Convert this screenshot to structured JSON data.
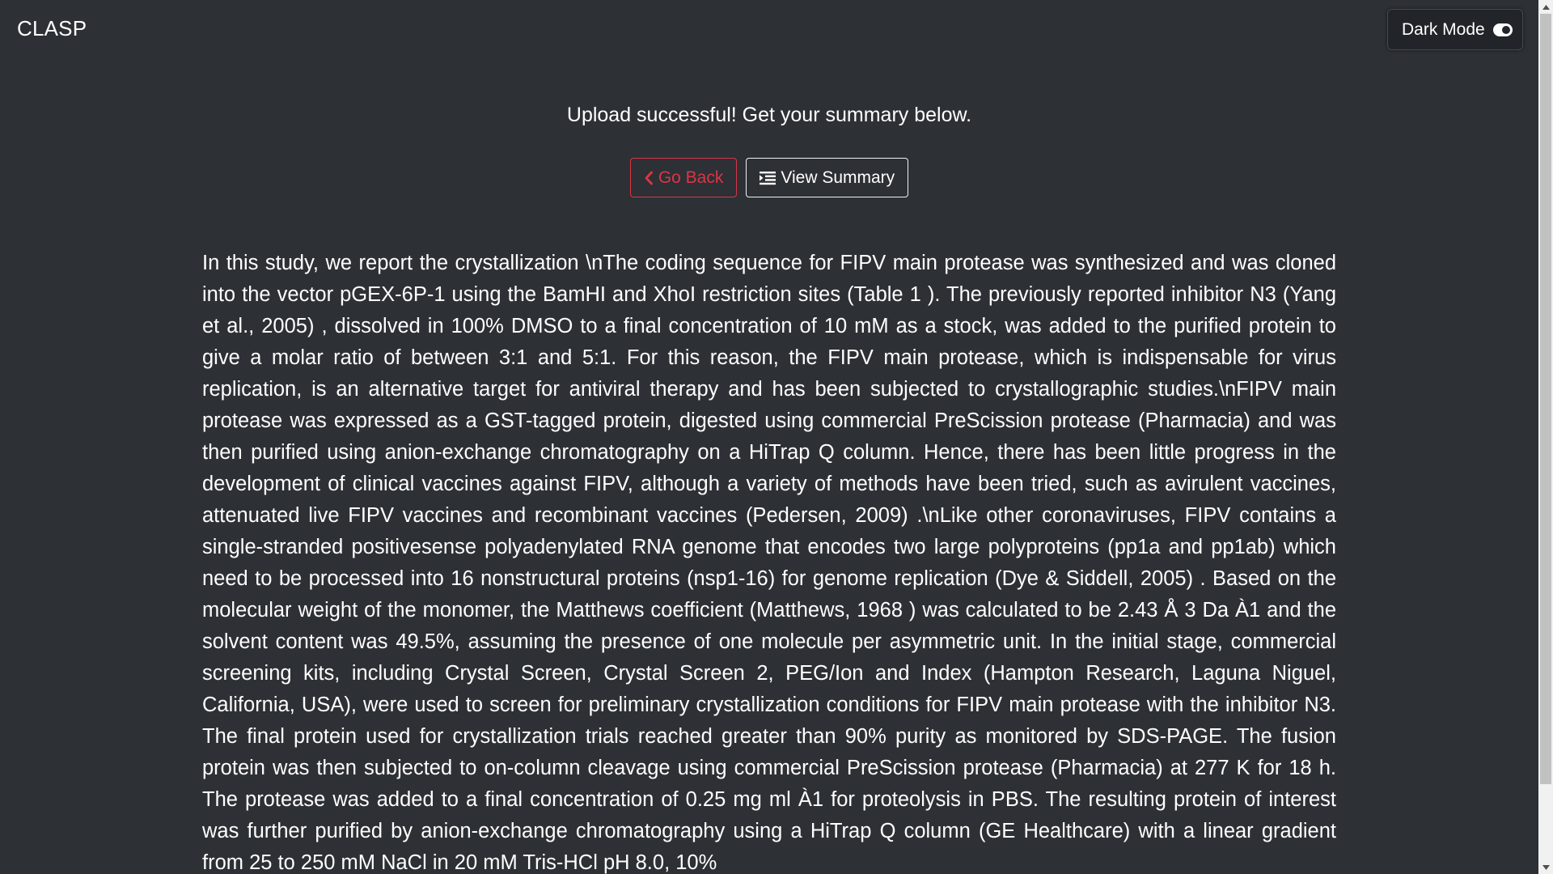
{
  "header": {
    "brand": "CLASP",
    "dark_mode_label": "Dark Mode",
    "dark_mode_icon": "toggle-on-icon"
  },
  "status_message": "Upload successful! Get your summary below.",
  "actions": {
    "go_back_label": "Go Back",
    "go_back_icon": "chevron-left-icon",
    "view_summary_label": "View Summary",
    "view_summary_icon": "list-indent-icon"
  },
  "summary_text": "In this study, we report the crystallization \\nThe coding sequence for FIPV main protease was synthesized and was cloned into the vector pGEX-6P-1 using the BamHI and XhoI restriction sites (Table 1 ). The previously reported inhibitor N3 (Yang et al., 2005) , dissolved in 100% DMSO to a final concentration of 10 mM as a stock, was added to the purified protein to give a molar ratio of between 3:1 and 5:1. For this reason, the FIPV main protease, which is indispensable for virus replication, is an alternative target for antiviral therapy and has been subjected to crystallographic studies.\\nFIPV main protease was expressed as a GST-tagged protein, digested using commercial PreScission protease (Pharmacia) and was then purified using anion-exchange chromatography on a HiTrap Q column. Hence, there has been little progress in the development of clinical vaccines against FIPV, although a variety of methods have been tried, such as avirulent vaccines, attenuated live FIPV vaccines and recombinant vaccines (Pedersen, 2009) .\\nLike other coronaviruses, FIPV contains a single-stranded positivesense polyadenylated RNA genome that encodes two large polyproteins (pp1a and pp1ab) which need to be processed into 16 nonstructural proteins (nsp1-16) for genome replication (Dye & Siddell, 2005) . Based on the molecular weight of the monomer, the Matthews coefficient (Matthews, 1968 ) was calculated to be 2.43 Å 3 Da À1 and the solvent content was 49.5%, assuming the presence of one molecule per asymmetric unit. In the initial stage, commercial screening kits, including Crystal Screen, Crystal Screen 2, PEG/Ion and Index (Hampton Research, Laguna Niguel, California, USA), were used to screen for preliminary crystallization conditions for FIPV main protease with the inhibitor N3. The final protein used for crystallization trials reached greater than 90% purity as monitored by SDS-PAGE. The fusion protein was then subjected to on-column cleavage using commercial PreScission protease (Pharmacia) at 277 K for 18 h. The protease was added to a final concentration of 0.25 mg ml À1 for proteolysis in PBS. The resulting protein of interest was further purified by anion-exchange chromatography using a HiTrap Q column (GE Healthcare) with a linear gradient from 25 to 250 mM NaCl in 20 mM Tris-HCl pH 8.0, 10%",
  "colors": {
    "background": "#2d3035",
    "danger": "#dc3545",
    "text": "#ffffff"
  }
}
